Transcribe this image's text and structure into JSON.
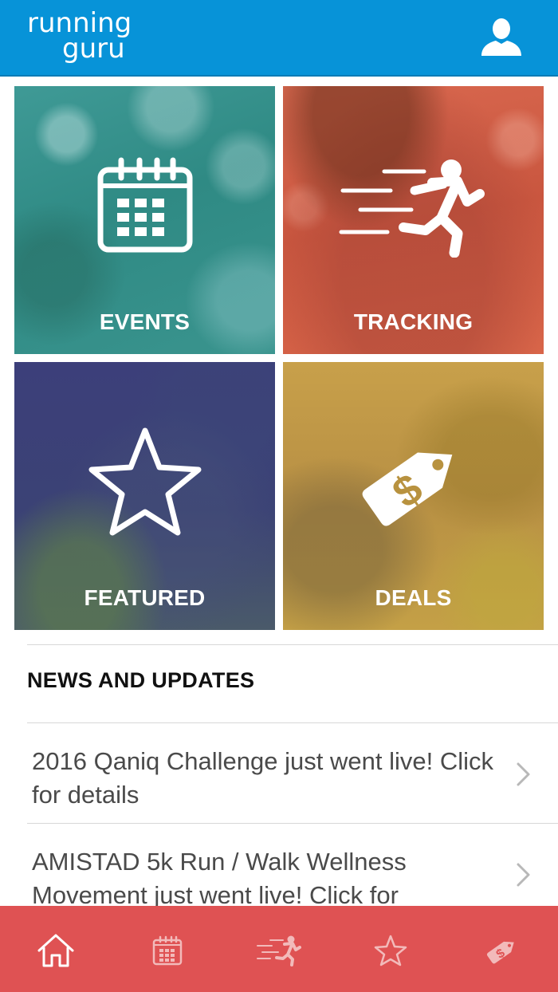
{
  "app": {
    "logo_line1": "running",
    "logo_line2": "guru",
    "brand_color": "#0793d8",
    "profile_icon": "user-icon"
  },
  "tiles": [
    {
      "label": "EVENTS",
      "icon": "calendar-icon",
      "color": "#3a948e"
    },
    {
      "label": "TRACKING",
      "icon": "runner-icon",
      "color": "#d05b44"
    },
    {
      "label": "FEATURED",
      "icon": "star-icon",
      "color": "#3c3f7a"
    },
    {
      "label": "DEALS",
      "icon": "price-tag-icon",
      "color": "#c09a48"
    }
  ],
  "news": {
    "title": "NEWS AND UPDATES",
    "items": [
      {
        "text": "2016 Qaniq Challenge just went live! Click for details"
      },
      {
        "text": "AMISTAD 5k Run / Walk Wellness Movement just went live! Click for"
      }
    ]
  },
  "tabbar": {
    "color": "#df5253",
    "active": "home",
    "tabs": [
      {
        "name": "home",
        "icon": "home-icon"
      },
      {
        "name": "events",
        "icon": "calendar-icon"
      },
      {
        "name": "tracking",
        "icon": "runner-icon"
      },
      {
        "name": "featured",
        "icon": "star-icon"
      },
      {
        "name": "deals",
        "icon": "price-tag-icon"
      }
    ]
  }
}
